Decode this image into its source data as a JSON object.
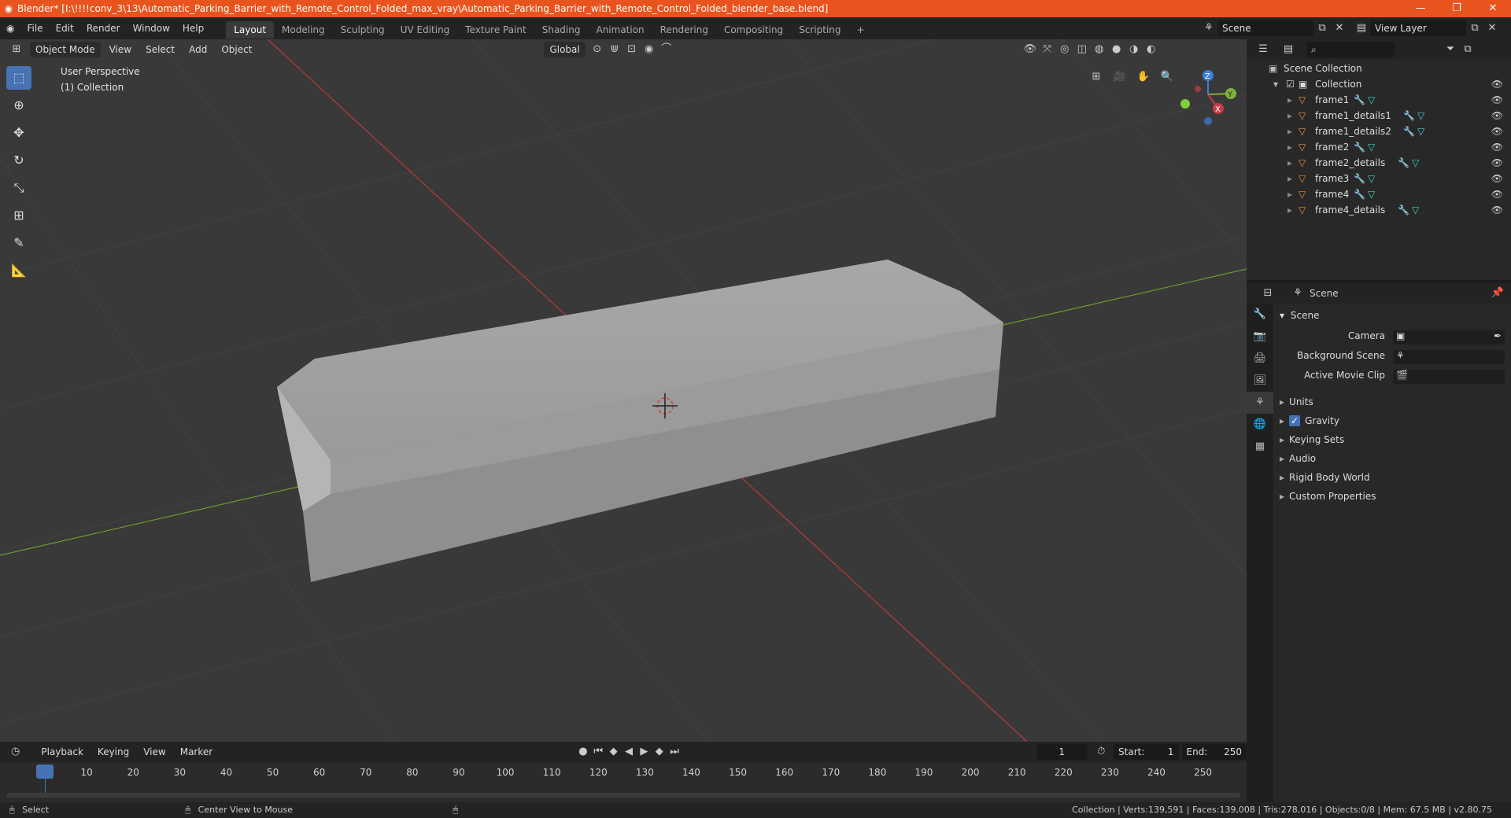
{
  "titlebar": {
    "title": "Blender* [I:\\!!!!conv_3\\13\\Automatic_Parking_Barrier_with_Remote_Control_Folded_max_vray\\Automatic_Parking_Barrier_with_Remote_Control_Folded_blender_base.blend]",
    "minimize": "—",
    "maximize": "❐",
    "close": "✕"
  },
  "menu": {
    "items": [
      "File",
      "Edit",
      "Render",
      "Window",
      "Help"
    ],
    "workspaces": [
      "Layout",
      "Modeling",
      "Sculpting",
      "UV Editing",
      "Texture Paint",
      "Shading",
      "Animation",
      "Rendering",
      "Compositing",
      "Scripting"
    ],
    "active_workspace": "Layout",
    "add_tab": "+",
    "scene": "Scene",
    "view_layer": "View Layer"
  },
  "viewport": {
    "mode": "Object Mode",
    "menus": [
      "View",
      "Select",
      "Add",
      "Object"
    ],
    "transform_orientation": "Global",
    "perspective_label": "User Perspective",
    "collection_label": "(1) Collection",
    "gizmo": {
      "x": "X",
      "y": "Y",
      "z": "Z"
    }
  },
  "outliner": {
    "root": "Scene Collection",
    "collection": "Collection",
    "objects": [
      {
        "name": "frame1",
        "has_modifier": true
      },
      {
        "name": "frame1_details1",
        "has_modifier": true
      },
      {
        "name": "frame1_details2",
        "has_modifier": true
      },
      {
        "name": "frame2",
        "has_modifier": true
      },
      {
        "name": "frame2_details",
        "has_modifier": true
      },
      {
        "name": "frame3",
        "has_modifier": true
      },
      {
        "name": "frame4",
        "has_modifier": true
      },
      {
        "name": "frame4_details",
        "has_modifier": true
      }
    ]
  },
  "properties": {
    "context": "Scene",
    "panel_title": "Scene",
    "fields": [
      {
        "label": "Camera",
        "value": ""
      },
      {
        "label": "Background Scene",
        "value": ""
      },
      {
        "label": "Active Movie Clip",
        "value": ""
      }
    ],
    "subpanels": [
      {
        "label": "Units",
        "checkbox": false
      },
      {
        "label": "Gravity",
        "checkbox": true
      },
      {
        "label": "Keying Sets",
        "checkbox": false
      },
      {
        "label": "Audio",
        "checkbox": false
      },
      {
        "label": "Rigid Body World",
        "checkbox": false
      },
      {
        "label": "Custom Properties",
        "checkbox": false
      }
    ]
  },
  "timeline": {
    "menus": [
      "Playback",
      "Keying",
      "View",
      "Marker"
    ],
    "current_frame": "1",
    "start_label": "Start:",
    "start": "1",
    "end_label": "End:",
    "end": "250",
    "ruler": [
      "1",
      "10",
      "20",
      "30",
      "40",
      "50",
      "60",
      "70",
      "80",
      "90",
      "100",
      "110",
      "120",
      "130",
      "140",
      "150",
      "160",
      "170",
      "180",
      "190",
      "200",
      "210",
      "220",
      "230",
      "240",
      "250"
    ]
  },
  "statusbar": {
    "left1": "Select",
    "left2": "Center View to Mouse",
    "stats": "Collection | Verts:139,591 | Faces:139,008 | Tris:278,016 | Objects:0/8 | Mem: 67.5 MB | v2.80.75"
  },
  "colors": {
    "titlebar": "#e9541e",
    "accent": "#4772b3",
    "x_axis": "#b8393a",
    "y_axis": "#6e9a2d",
    "object_icon": "#e8913a",
    "mesh_icon": "#3fd6c3"
  }
}
